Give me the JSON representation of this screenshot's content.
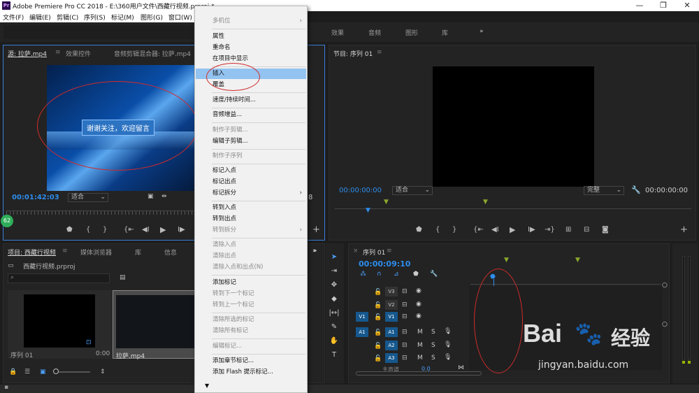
{
  "titlebar": {
    "logo": "Pr",
    "title": "Adobe Premiere Pro CC 2018 - E:\\360用户文件\\西藏行视频.prproj *",
    "minimize": "—",
    "maximize": "❐",
    "close": "✕"
  },
  "menu": [
    "文件(F)",
    "编辑(E)",
    "剪辑(C)",
    "序列(S)",
    "标记(M)",
    "图形(G)",
    "窗口(W)"
  ],
  "workspaces": [
    "效果",
    "音频",
    "图形",
    "库"
  ],
  "ws_more": "»",
  "source": {
    "tabs": [
      "源: 拉萨.mp4",
      "效果控件",
      "音频剪辑混合器: 拉萨.mp4"
    ],
    "menu_icon": "≡",
    "timecode": "00:01:42:03",
    "fit": "适合",
    "caption": "谢谢关注，欢迎留言",
    "frame_suffix": "8",
    "badge": "62"
  },
  "program": {
    "tab": "节目: 序列 01",
    "menu_icon": "≡",
    "timecode_left": "00:00:00:00",
    "fit": "适合",
    "quality": "完整",
    "timecode_right": "00:00:00:00"
  },
  "project": {
    "tabs": [
      "项目: 西藏行视频",
      "媒体浏览器",
      "库",
      "信息"
    ],
    "menu_icon": "≡",
    "file": "西藏行视频.prproj",
    "items": [
      {
        "name": "序列 01",
        "dur": "0:00"
      },
      {
        "name": "拉萨.mp4",
        "dur": ""
      }
    ],
    "more": "»"
  },
  "timeline": {
    "tab": "序列 01",
    "close": "×",
    "menu_icon": "≡",
    "timecode": "00:00:09:10",
    "video_tracks": [
      "V3",
      "V2",
      "V1"
    ],
    "audio_tracks": [
      "A1",
      "A2",
      "A3"
    ],
    "v1_source": "V1",
    "a1_source": "A1",
    "mute": "M",
    "solo": "S",
    "master": "主声道",
    "master_val": "0.0"
  },
  "context_menu": {
    "items": [
      {
        "label": "多机位",
        "disabled": true,
        "submenu": true
      },
      {
        "label": "属性"
      },
      {
        "label": "重命名"
      },
      {
        "label": "在项目中显示"
      },
      {
        "label": "插入",
        "highlight": true
      },
      {
        "label": "覆盖"
      },
      {
        "label": "速度/持续时间..."
      },
      {
        "label": "音频增益..."
      },
      {
        "label": "制作子剪辑...",
        "disabled": true
      },
      {
        "label": "编辑子剪辑..."
      },
      {
        "label": "制作子序列",
        "disabled": true
      },
      {
        "label": "标记入点"
      },
      {
        "label": "标记出点"
      },
      {
        "label": "标记拆分",
        "submenu": true
      },
      {
        "label": "转到入点"
      },
      {
        "label": "转到出点"
      },
      {
        "label": "转到拆分",
        "disabled": true,
        "submenu": true
      },
      {
        "label": "清除入点",
        "disabled": true
      },
      {
        "label": "清除出点",
        "disabled": true
      },
      {
        "label": "清除入点和出点(N)",
        "disabled": true
      },
      {
        "label": "添加标记"
      },
      {
        "label": "转到下一个标记",
        "disabled": true
      },
      {
        "label": "转到上一个标记",
        "disabled": true
      },
      {
        "label": "清除所选的标记",
        "disabled": true
      },
      {
        "label": "清除所有标记",
        "disabled": true
      },
      {
        "label": "编辑标记...",
        "disabled": true
      },
      {
        "label": "添加章节标记..."
      },
      {
        "label": "添加 Flash 提示标记..."
      }
    ],
    "scroll_down": "▼",
    "submenu_arrow": "›"
  },
  "watermark": {
    "brand": "Bai",
    "brand2": "经验",
    "url": "jingyan.baidu.com"
  },
  "colors": {
    "accent": "#2d8ceb",
    "annotation": "#d12b2b",
    "highlight": "#93c3f0"
  }
}
